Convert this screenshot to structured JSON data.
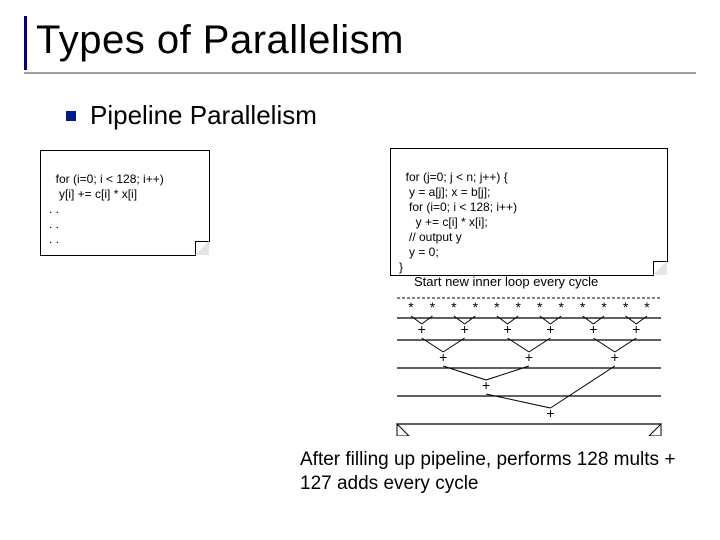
{
  "title": "Types of Parallelism",
  "subhead": "Pipeline Parallelism",
  "code_left": "for (i=0; i < 128; i++)\n   y[i] += c[i] * x[i]\n. .\n. .\n. .",
  "code_right": "for (j=0; j < n; j++) {\n   y = a[j]; x = b[j];\n   for (i=0; i < 128; i++)\n     y += c[i] * x[i];\n   // output y\n   y = 0;\n}",
  "annot_start": "Start new inner loop every cycle",
  "tree": {
    "mul_symbol": "*",
    "add_symbol": "+",
    "n_leaves": 12
  },
  "conclusion": "After filling up pipeline, performs 128 mults + 127 adds every cycle"
}
